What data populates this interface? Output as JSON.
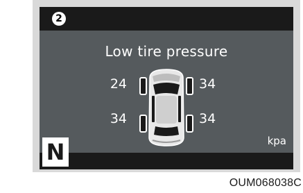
{
  "callout_number": "2",
  "message": "Low tire pressure",
  "tires": {
    "front_left": "24",
    "front_right": "34",
    "rear_left": "34",
    "rear_right": "34"
  },
  "unit": "kpa",
  "gear": "N",
  "caption": "OUM068038C",
  "colors": {
    "display_background": "#555a5d",
    "bars": "#1a1a1a",
    "text": "#ffffff",
    "bezel": "#d9d9d9"
  },
  "icons": [
    "car-top-view-icon",
    "callout-number-icon"
  ]
}
